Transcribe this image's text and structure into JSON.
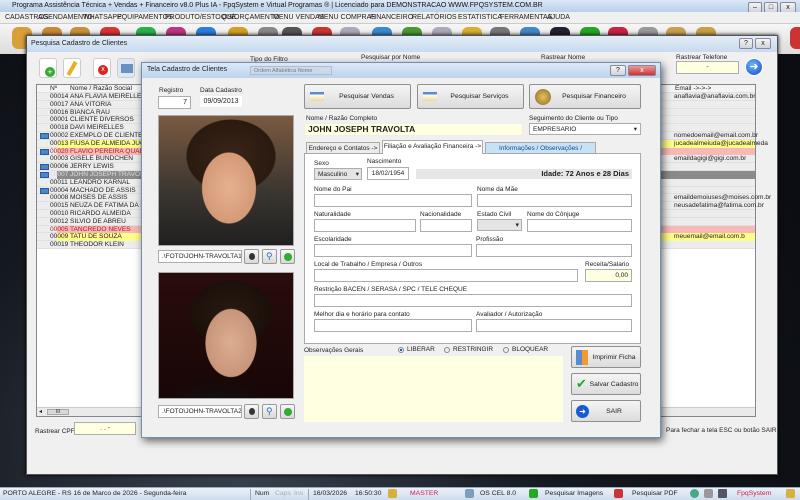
{
  "app": {
    "title": "Programa Assistência Técnica + Vendas + Financeiro v8.0 Plus IA - FpqSystem e Virtual Programas ® | Licenciado para  DEMONSTRACAO WWW.FPQSYSTEM.COM.BR"
  },
  "menu": [
    "CADASTROS",
    "AGENDAMENTO",
    "WHATSAPP",
    "EQUIPAMENTOS",
    "PRODUTO/ESTOQUE",
    "OS/ORÇAMENTO",
    "MENU VENDAS",
    "MENU COMPRAS",
    "FINANCEIRO",
    "RELATÓRIOS",
    "ESTATISTICA",
    "FERRAMENTAS",
    "AJUDA"
  ],
  "toolbar_icons": [
    {
      "name": "user-icon",
      "color": "#d9a03a"
    },
    {
      "name": "user-icon",
      "color": "#c98a35"
    },
    {
      "name": "user-icon",
      "color": "#c9923a"
    },
    {
      "name": "calendar-icon",
      "color": "#d33"
    },
    {
      "name": "whatsapp-icon",
      "color": "#27b34a"
    },
    {
      "name": "instagram-icon",
      "color": "#c13584"
    },
    {
      "name": "sms-icon",
      "color": "#2a7de1"
    },
    {
      "name": "equipment-icon",
      "color": "#d4a020"
    },
    {
      "name": "tools-icon",
      "color": "#888"
    },
    {
      "name": "printer-icon",
      "color": "#555"
    },
    {
      "name": "shop-icon",
      "color": "#c33"
    },
    {
      "name": "document-icon",
      "color": "#aab"
    },
    {
      "name": "money-icon",
      "color": "#3a8ad0"
    },
    {
      "name": "cart-icon",
      "color": "#4a9a30"
    },
    {
      "name": "document-icon",
      "color": "#aab"
    },
    {
      "name": "coins-icon",
      "color": "#d8b030"
    },
    {
      "name": "key-icon",
      "color": "#777"
    },
    {
      "name": "chart-icon",
      "color": "#48c"
    },
    {
      "name": "graduation-icon",
      "color": "#223"
    },
    {
      "name": "green-circle-icon",
      "color": "#2a2"
    },
    {
      "name": "red-circle-icon",
      "color": "#c24"
    },
    {
      "name": "settings-icon",
      "color": "#999"
    },
    {
      "name": "archive-icon",
      "color": "#c9a050"
    },
    {
      "name": "coin-icon",
      "color": "#c9a040"
    },
    {
      "name": "exit-icon",
      "color": "#c33"
    }
  ],
  "outer": {
    "title": "Pesquisa Cadastro de Clientes",
    "filter_label": "Tipo do Filtro",
    "filter_value": "Ordem Alfabética Nome",
    "search_name_label": "Pesquisar por Nome",
    "track_name_label": "Rastrear Nome",
    "track_phone_label": "Rastrear Telefone",
    "track_phone_value": "-",
    "track_cpf_label": "Rastrear CPF",
    "track_cpf_value": ". . -",
    "close_hint": "Para fechar a tela ESC ou botão SAIR",
    "scroll_thumb": "III"
  },
  "grid": {
    "headers": {
      "num": "Nº",
      "name": "Nome / Razão Social",
      "email": "Email ->->->"
    },
    "rows": [
      {
        "num": "00014",
        "name": "ANA FLAVIA MEIRELLES",
        "email": "anaflavia@anaflavia.com.br",
        "style": "normal",
        "icon": false
      },
      {
        "num": "00017",
        "name": "ANA VITÓRIA",
        "email": "",
        "style": "normal",
        "icon": false
      },
      {
        "num": "00016",
        "name": "BIANCA RAU",
        "email": "",
        "style": "normal",
        "icon": false
      },
      {
        "num": "00001",
        "name": "CLIENTE DIVERSOS",
        "email": "",
        "style": "normal",
        "icon": false
      },
      {
        "num": "00018",
        "name": "DAVI MEIRELLES",
        "email": "",
        "style": "normal",
        "icon": false
      },
      {
        "num": "00002",
        "name": "EXEMPLO DE CLIENTE",
        "email": "nomedoemail@email.com.br",
        "style": "normal",
        "icon": true
      },
      {
        "num": "00013",
        "name": "FIUSA DE ALMEIDA JUCA",
        "email": "jucadealmeiuda@jucadealmeda",
        "style": "yellow",
        "icon": false
      },
      {
        "num": "00020",
        "name": "FLAVIO PEREIRA QUADROS",
        "email": "",
        "style": "pink",
        "icon": true
      },
      {
        "num": "00003",
        "name": "GISELE BUNDCHEN",
        "email": "emaildagigi@gigi.com.br",
        "style": "normal",
        "icon": false
      },
      {
        "num": "00006",
        "name": "JERRY LEWIS",
        "email": "",
        "style": "normal",
        "icon": true
      },
      {
        "num": "00007",
        "name": "JOHN JOSEPH TRAVOLTA",
        "email": "",
        "style": "selected",
        "icon": true
      },
      {
        "num": "00011",
        "name": "LEANDRO KARNAL",
        "email": "",
        "style": "normal",
        "icon": false
      },
      {
        "num": "00004",
        "name": "MACHADO DE ASSIS",
        "email": "",
        "style": "normal",
        "icon": true
      },
      {
        "num": "00008",
        "name": "MOISES DE ASSIS",
        "email": "emaildemoiuses@moises.com.br",
        "style": "normal",
        "icon": false
      },
      {
        "num": "00015",
        "name": "NEUZA DE FATIMA DA SILVA",
        "email": "neusadefatima@fatima.com.br",
        "style": "normal",
        "icon": false
      },
      {
        "num": "00010",
        "name": "RICARDO ALMEIDA",
        "email": "",
        "style": "normal",
        "icon": false
      },
      {
        "num": "00012",
        "name": "SILVIO DE ABREU",
        "email": "",
        "style": "normal",
        "icon": false
      },
      {
        "num": "00005",
        "name": "TANCREDO NEVES",
        "email": "",
        "style": "pink",
        "icon": false
      },
      {
        "num": "00009",
        "name": "TATU DE SOUZA",
        "email": "meuemail@email.com.b",
        "style": "yellow",
        "icon": false
      },
      {
        "num": "00019",
        "name": "THEODOR KLEIN",
        "email": "",
        "style": "normal",
        "icon": false
      }
    ]
  },
  "colors": {
    "yellow": "#fdfd8a",
    "pink": "#f7b8b8",
    "selected": "#8a8a8a",
    "normal": "#ededed",
    "input_yellow": "#ffffe1",
    "tab_blue": "#c7e1f7"
  },
  "modal": {
    "title": "Tela Cadastro de Clientes",
    "help": "?",
    "close": "x",
    "registro_label": "Registro",
    "registro": "7",
    "data_cadastro_label": "Data Cadastro",
    "data_cadastro": "09/09/2013",
    "foto1": ".\\FOTO\\JOHN-TRAVOLTA1.",
    "foto2": ".\\FOTO\\JOHN-TRAVOLTA2.",
    "btn_vendas": "Pesquisar Vendas",
    "btn_servicos": "Pesquisar Serviços",
    "btn_financeiro": "Pesquisar  Financeiro",
    "nome_label": "Nome / Razão Completo",
    "nome": "JOHN JOSEPH TRAVOLTA",
    "segmento_label": "Seguimento do Cliente ou Tipo",
    "segmento": "EMPRESARIO",
    "tabs": [
      "Endereço e Contatos ->",
      "Filiação e Avaliação Financeira ->",
      "Informações / Observações / Histórico"
    ],
    "sexo_label": "Sexo",
    "sexo": "Masculino",
    "nascimento_label": "Nascimento",
    "nascimento": "18/02/1954",
    "idade": "Idade: 72 Anos  e 28 Dias",
    "pai_label": "Nome do Pai",
    "mae_label": "Nome da Mãe",
    "naturalidade_label": "Naturalidade",
    "nacionalidade_label": "Nacionalidade",
    "estado_civil_label": "Estado Civil",
    "conjuge_label": "Nome do Cônjuge",
    "escolaridade_label": "Escolaridade",
    "profissao_label": "Profissão",
    "trabalho_label": "Local de Trabalho / Empresa / Outros",
    "receita_label": "Receita/Salario",
    "receita": "0,00",
    "restricao_label": "Restrição BACEN / SERASA / SPC / TELE CHEQUE",
    "contato_label": "Melhor dia e horário para contato",
    "avaliador_label": "Avaliador / Autorização",
    "obs_label": "Observações Gerais",
    "radios": [
      {
        "label": "LIBERAR",
        "checked": true
      },
      {
        "label": "RESTRINGIR",
        "checked": false
      },
      {
        "label": "BLOQUEAR",
        "checked": false
      }
    ],
    "btn_imprimir": "Imprimir Ficha",
    "btn_salvar": "Salvar Cadastro",
    "btn_sair": "SAIR"
  },
  "status": {
    "location": "PORTO ALEGRE - RS 16 de Marco de 2026 - Segunda-feira",
    "num": "Num",
    "caps": "Caps",
    "ins": "Ins",
    "date": "16/03/2026",
    "time": "16:50:30",
    "user": "MASTER",
    "os": "OS CEL 8.0",
    "imagens": "Pesquisar Imagens",
    "pdf": "Pesquisar PDF",
    "brand": "FpqSystem"
  }
}
